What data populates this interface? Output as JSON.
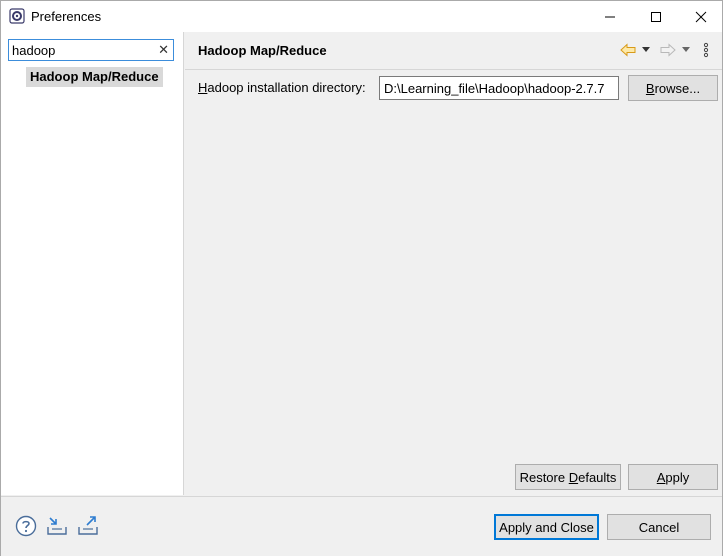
{
  "window": {
    "title": "Preferences"
  },
  "sidebar": {
    "filter_value": "hadoop",
    "clear_glyph": "✕",
    "items": [
      {
        "label": "Hadoop Map/Reduce"
      }
    ]
  },
  "page": {
    "title": "Hadoop Map/Reduce",
    "install_label_first": "H",
    "install_label_rest": "adoop installation directory:",
    "install_value": "D:\\Learning_file\\Hadoop\\hadoop-2.7.7",
    "browse_first": "B",
    "browse_rest": "rowse...",
    "restore_pre": "Restore ",
    "restore_accel": "D",
    "restore_post": "efaults",
    "apply_accel": "A",
    "apply_rest": "pply"
  },
  "footer": {
    "apply_close_label": "Apply and Close",
    "cancel_label": "Cancel"
  },
  "colors": {
    "accent": "#0078d7",
    "back_arrow": "#e8a317",
    "forward_arrow": "#bfbfbf"
  },
  "icons": [
    "app-icon",
    "minimize-icon",
    "maximize-icon",
    "close-icon",
    "back-arrow-icon",
    "forward-arrow-icon",
    "dropdown-icon",
    "view-menu-icon",
    "help-icon",
    "import-icon",
    "export-icon",
    "clear-filter-icon"
  ]
}
